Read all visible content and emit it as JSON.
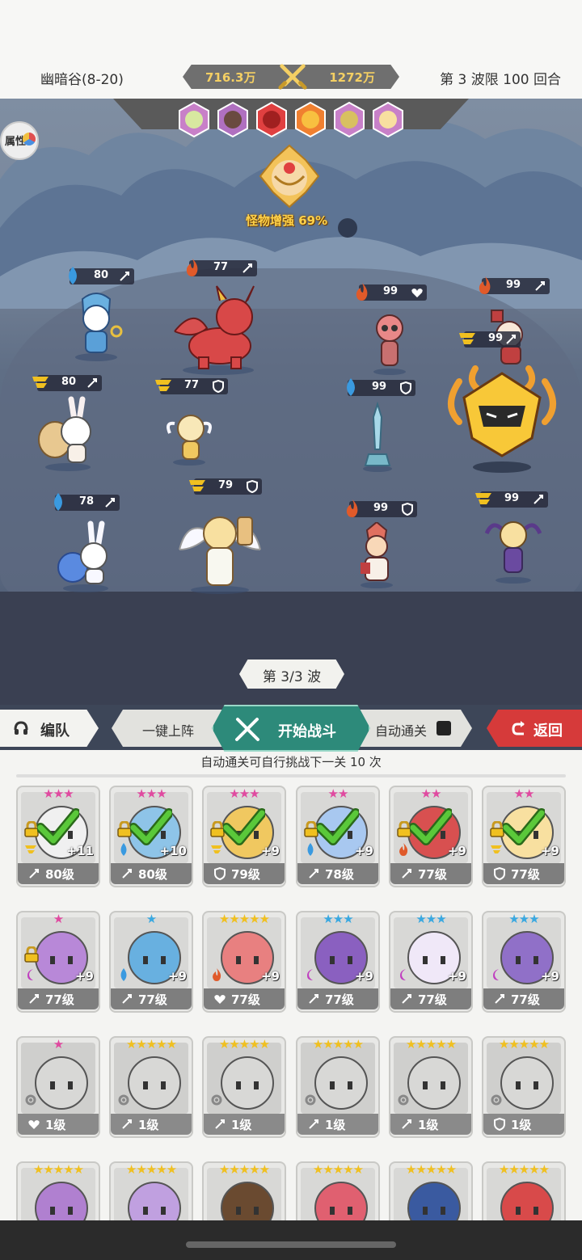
{
  "header": {
    "stage": "幽暗谷(8-20)",
    "our_power": "716.3万",
    "enemy_power": "1272万",
    "wave_limit": "第 3 波限 100 回合"
  },
  "field": {
    "attribute_button": "属性",
    "boss_buff": "怪物增强 69%",
    "wave_indicator": "第 3/3 波",
    "ally_units": [
      {
        "level": "80",
        "element": "water",
        "role": "attack"
      },
      {
        "level": "80",
        "element": "wind",
        "role": "attack"
      },
      {
        "level": "78",
        "element": "water",
        "role": "attack"
      },
      {
        "level": "77",
        "element": "fire",
        "role": "attack"
      },
      {
        "level": "77",
        "element": "wind",
        "role": "defense"
      },
      {
        "level": "79",
        "element": "wind",
        "role": "defense"
      }
    ],
    "enemy_units": [
      {
        "level": "99",
        "element": "fire",
        "role": "heal"
      },
      {
        "level": "99",
        "element": "water",
        "role": "defense"
      },
      {
        "level": "99",
        "element": "fire",
        "role": "defense"
      },
      {
        "level": "99",
        "element": "fire",
        "role": "attack"
      },
      {
        "level": "99",
        "element": "wind",
        "role": "attack"
      },
      {
        "level": "99",
        "element": "wind",
        "role": "attack"
      }
    ]
  },
  "actions": {
    "team": "编队",
    "auto_deploy": "一键上阵",
    "start_battle": "开始战斗",
    "auto_clear": "自动通关",
    "back": "返回"
  },
  "auto_clear_note": "自动通关可自行挑战下一关 10 次",
  "roster": [
    {
      "stars": "★★★",
      "star_color": "#e04aa0",
      "plus": "+11",
      "level": "80级",
      "role": "attack",
      "element": "wind",
      "deployed": true,
      "locked": true,
      "color": "#f0f0f0"
    },
    {
      "stars": "★★★",
      "star_color": "#e04aa0",
      "plus": "+10",
      "level": "80级",
      "role": "attack",
      "element": "water",
      "deployed": true,
      "locked": true,
      "color": "#8ec4e8"
    },
    {
      "stars": "★★★",
      "star_color": "#e04aa0",
      "plus": "+9",
      "level": "79级",
      "role": "defense",
      "element": "wind",
      "deployed": true,
      "locked": true,
      "color": "#f0c860"
    },
    {
      "stars": "★★",
      "star_color": "#e04aa0",
      "plus": "+9",
      "level": "78级",
      "role": "attack",
      "element": "water",
      "deployed": true,
      "locked": true,
      "color": "#a8c8f0"
    },
    {
      "stars": "★★",
      "star_color": "#e04aa0",
      "plus": "+9",
      "level": "77级",
      "role": "attack",
      "element": "fire",
      "deployed": true,
      "locked": true,
      "color": "#d85050"
    },
    {
      "stars": "★★",
      "star_color": "#e04aa0",
      "plus": "+9",
      "level": "77级",
      "role": "defense",
      "element": "wind",
      "deployed": true,
      "locked": true,
      "color": "#f8e0a0"
    },
    {
      "stars": "★",
      "star_color": "#e04aa0",
      "plus": "+9",
      "level": "77级",
      "role": "attack",
      "element": "dark",
      "deployed": false,
      "locked": true,
      "color": "#b888d8"
    },
    {
      "stars": "★",
      "star_color": "#3aa8e0",
      "plus": "+9",
      "level": "77级",
      "role": "attack",
      "element": "water",
      "deployed": false,
      "locked": false,
      "color": "#68b0e0"
    },
    {
      "stars": "★★★★★",
      "star_color": "#f0c020",
      "plus": "+9",
      "level": "77级",
      "role": "heal",
      "element": "fire",
      "deployed": false,
      "locked": false,
      "color": "#e88080"
    },
    {
      "stars": "★★★",
      "star_color": "#3aa8e0",
      "plus": "+9",
      "level": "77级",
      "role": "attack",
      "element": "dark",
      "deployed": false,
      "locked": false,
      "color": "#8a60c0"
    },
    {
      "stars": "★★★",
      "star_color": "#3aa8e0",
      "plus": "+9",
      "level": "77级",
      "role": "attack",
      "element": "dark",
      "deployed": false,
      "locked": false,
      "color": "#f0e8f8"
    },
    {
      "stars": "★★★",
      "star_color": "#3aa8e0",
      "plus": "+9",
      "level": "77级",
      "role": "attack",
      "element": "dark",
      "deployed": false,
      "locked": false,
      "color": "#9070c8"
    },
    {
      "stars": "★",
      "star_color": "#e04aa0",
      "plus": "",
      "level": "1级",
      "role": "heal",
      "element": "gear",
      "deployed": false,
      "locked": false,
      "color": "#d8d8d6"
    },
    {
      "stars": "★★★★★",
      "star_color": "#f0c020",
      "plus": "",
      "level": "1级",
      "role": "attack",
      "element": "gear",
      "deployed": false,
      "locked": false,
      "color": "#d8d8d6"
    },
    {
      "stars": "★★★★★",
      "star_color": "#f0c020",
      "plus": "",
      "level": "1级",
      "role": "attack",
      "element": "gear",
      "deployed": false,
      "locked": false,
      "color": "#d8d8d6"
    },
    {
      "stars": "★★★★★",
      "star_color": "#f0c020",
      "plus": "",
      "level": "1级",
      "role": "attack",
      "element": "gear",
      "deployed": false,
      "locked": false,
      "color": "#d8d8d6"
    },
    {
      "stars": "★★★★★",
      "star_color": "#f0c020",
      "plus": "",
      "level": "1级",
      "role": "attack",
      "element": "gear",
      "deployed": false,
      "locked": false,
      "color": "#d8d8d6"
    },
    {
      "stars": "★★★★★",
      "star_color": "#f0c020",
      "plus": "",
      "level": "1级",
      "role": "defense",
      "element": "gear",
      "deployed": false,
      "locked": false,
      "color": "#d8d8d6"
    },
    {
      "stars": "★★★★★",
      "star_color": "#f0c020",
      "plus": "",
      "level": "",
      "role": "",
      "element": "",
      "deployed": false,
      "locked": false,
      "color": "#b080d0"
    },
    {
      "stars": "★★★★★",
      "star_color": "#f0c020",
      "plus": "",
      "level": "",
      "role": "",
      "element": "",
      "deployed": false,
      "locked": false,
      "color": "#c0a0e0"
    },
    {
      "stars": "★★★★★",
      "star_color": "#f0c020",
      "plus": "",
      "level": "",
      "role": "",
      "element": "",
      "deployed": false,
      "locked": false,
      "color": "#6a4a30"
    },
    {
      "stars": "★★★★★",
      "star_color": "#f0c020",
      "plus": "",
      "level": "",
      "role": "",
      "element": "",
      "deployed": false,
      "locked": false,
      "color": "#e06070"
    },
    {
      "stars": "★★★★★",
      "star_color": "#f0c020",
      "plus": "",
      "level": "",
      "role": "",
      "element": "",
      "deployed": false,
      "locked": false,
      "color": "#3a5aa0"
    },
    {
      "stars": "★★★★★",
      "star_color": "#f0c020",
      "plus": "",
      "level": "",
      "role": "",
      "element": "",
      "deployed": false,
      "locked": false,
      "color": "#d84a4a"
    }
  ],
  "colors": {
    "accent_green": "#2d8a7a",
    "back_red": "#d63a3a",
    "power_gold": "#f4cf63",
    "check_green": "#5ac83a"
  }
}
